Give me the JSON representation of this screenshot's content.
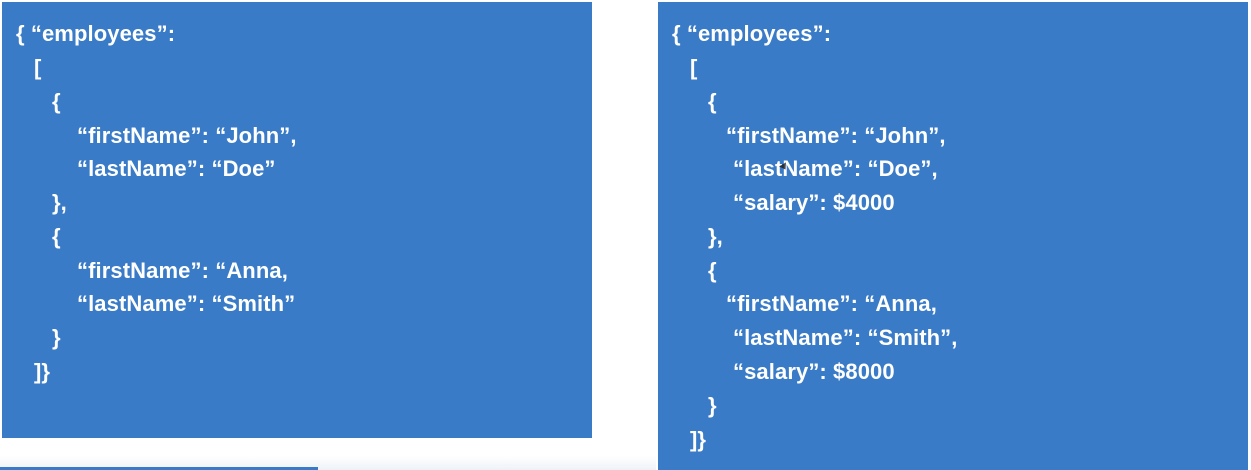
{
  "left_panel": {
    "lines": [
      "{ “employees”:",
      "[",
      "{",
      "“firstName”: “John”,",
      "“lastName”: “Doe”",
      "},",
      "{",
      "“firstName”: “Anna,",
      "“lastName”: “Smith”",
      "}",
      "]}"
    ]
  },
  "right_panel": {
    "lines": [
      "{ “employees”:",
      "[",
      "{",
      "“firstName”: “John”,",
      "“lastName”: “Doe”,",
      "“salary”: $4000",
      "},",
      "{",
      "“firstName”: “Anna,",
      "“lastName”: “Smith”,",
      "“salary”: $8000",
      "}",
      "]}"
    ]
  },
  "colors": {
    "panel_background": "#3a7bc8",
    "text": "#ffffff"
  }
}
